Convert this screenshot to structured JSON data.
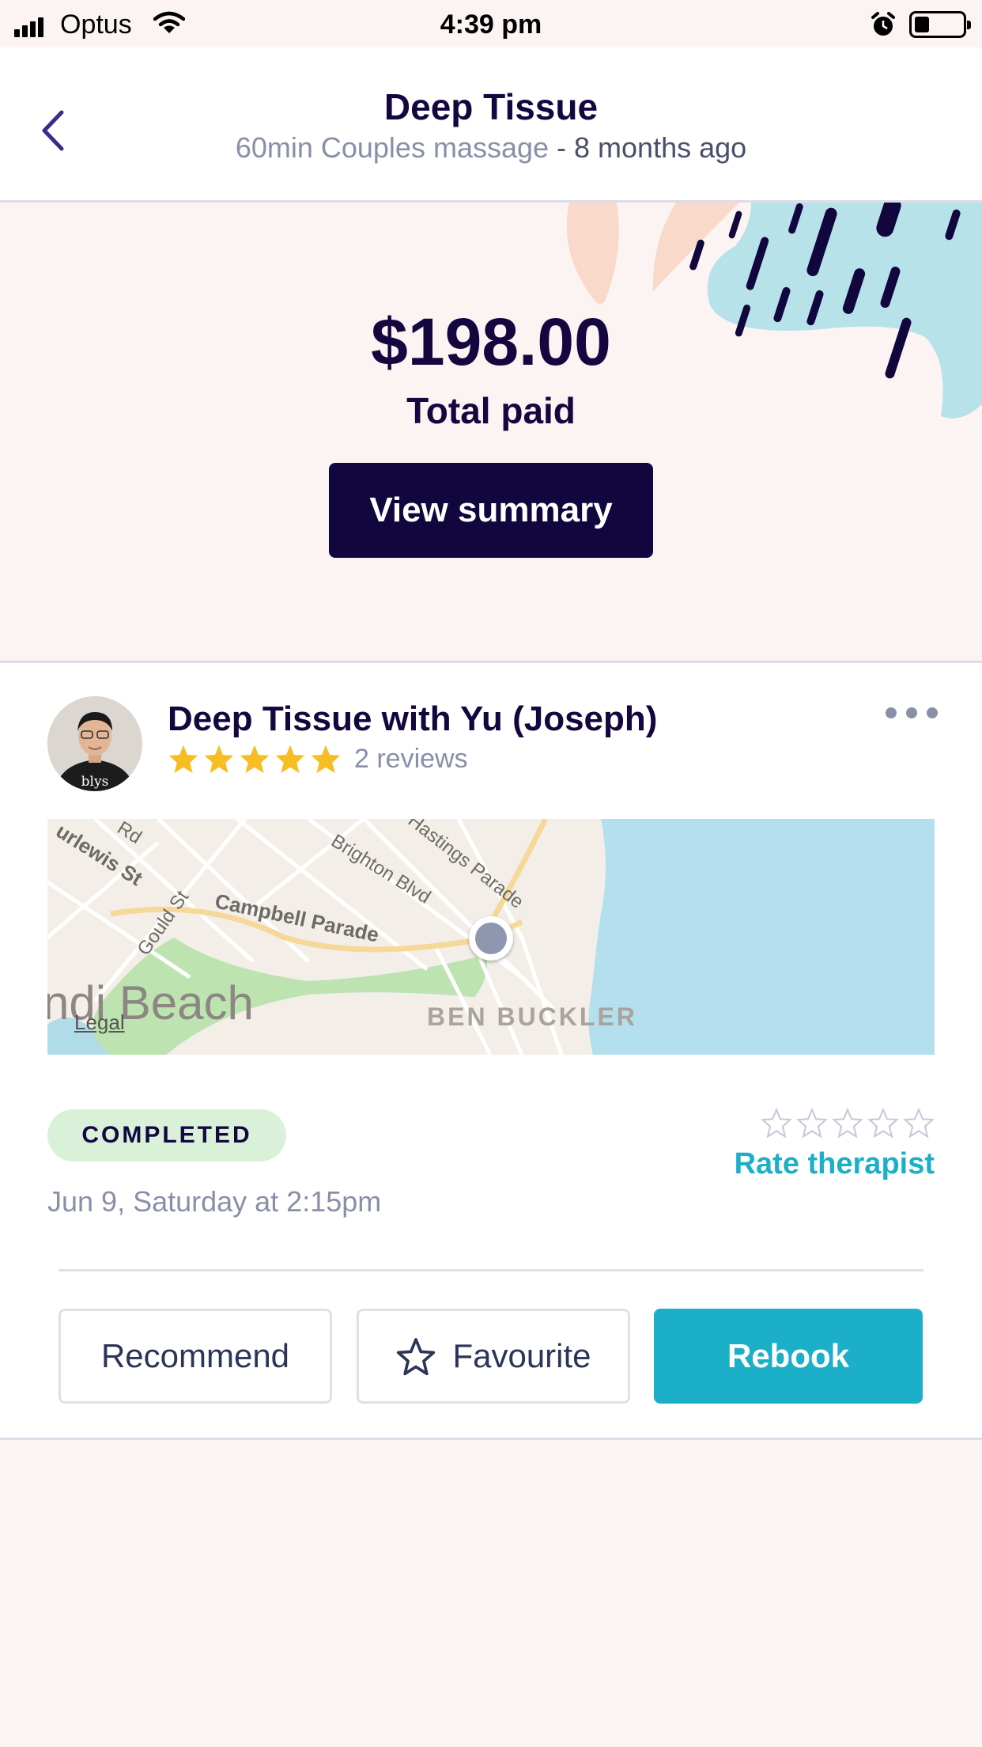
{
  "status_bar": {
    "carrier": "Optus",
    "time": "4:39 pm"
  },
  "header": {
    "title": "Deep Tissue",
    "subtitle_service": "60min Couples massage",
    "subtitle_when": " - 8 months ago"
  },
  "hero": {
    "amount": "$198.00",
    "amount_label": "Total paid",
    "view_summary_label": "View summary"
  },
  "booking": {
    "therapist_title": "Deep Tissue with Yu (Joseph)",
    "avatar_shirt_text": "blys",
    "rating_stars": 5,
    "reviews": "2 reviews",
    "status": "COMPLETED",
    "date": "Jun 9, Saturday at 2:15pm",
    "rate_label": "Rate therapist",
    "user_rating": 0
  },
  "map": {
    "streets": [
      "urlewis St",
      "Rd",
      "Gould St",
      "Campbell Parade",
      "Brighton Blvd",
      "Hastings Parade"
    ],
    "beach": "ndi Beach",
    "suburb": "BEN BUCKLER",
    "legal": "Legal"
  },
  "actions": {
    "recommend": "Recommend",
    "favourite": "Favourite",
    "rebook": "Rebook"
  },
  "colors": {
    "navy": "#12063f",
    "teal": "#1cb0c8",
    "star_gold": "#f7bd23",
    "badge_green": "#d8f1d8",
    "background": "#fbf4f3"
  }
}
